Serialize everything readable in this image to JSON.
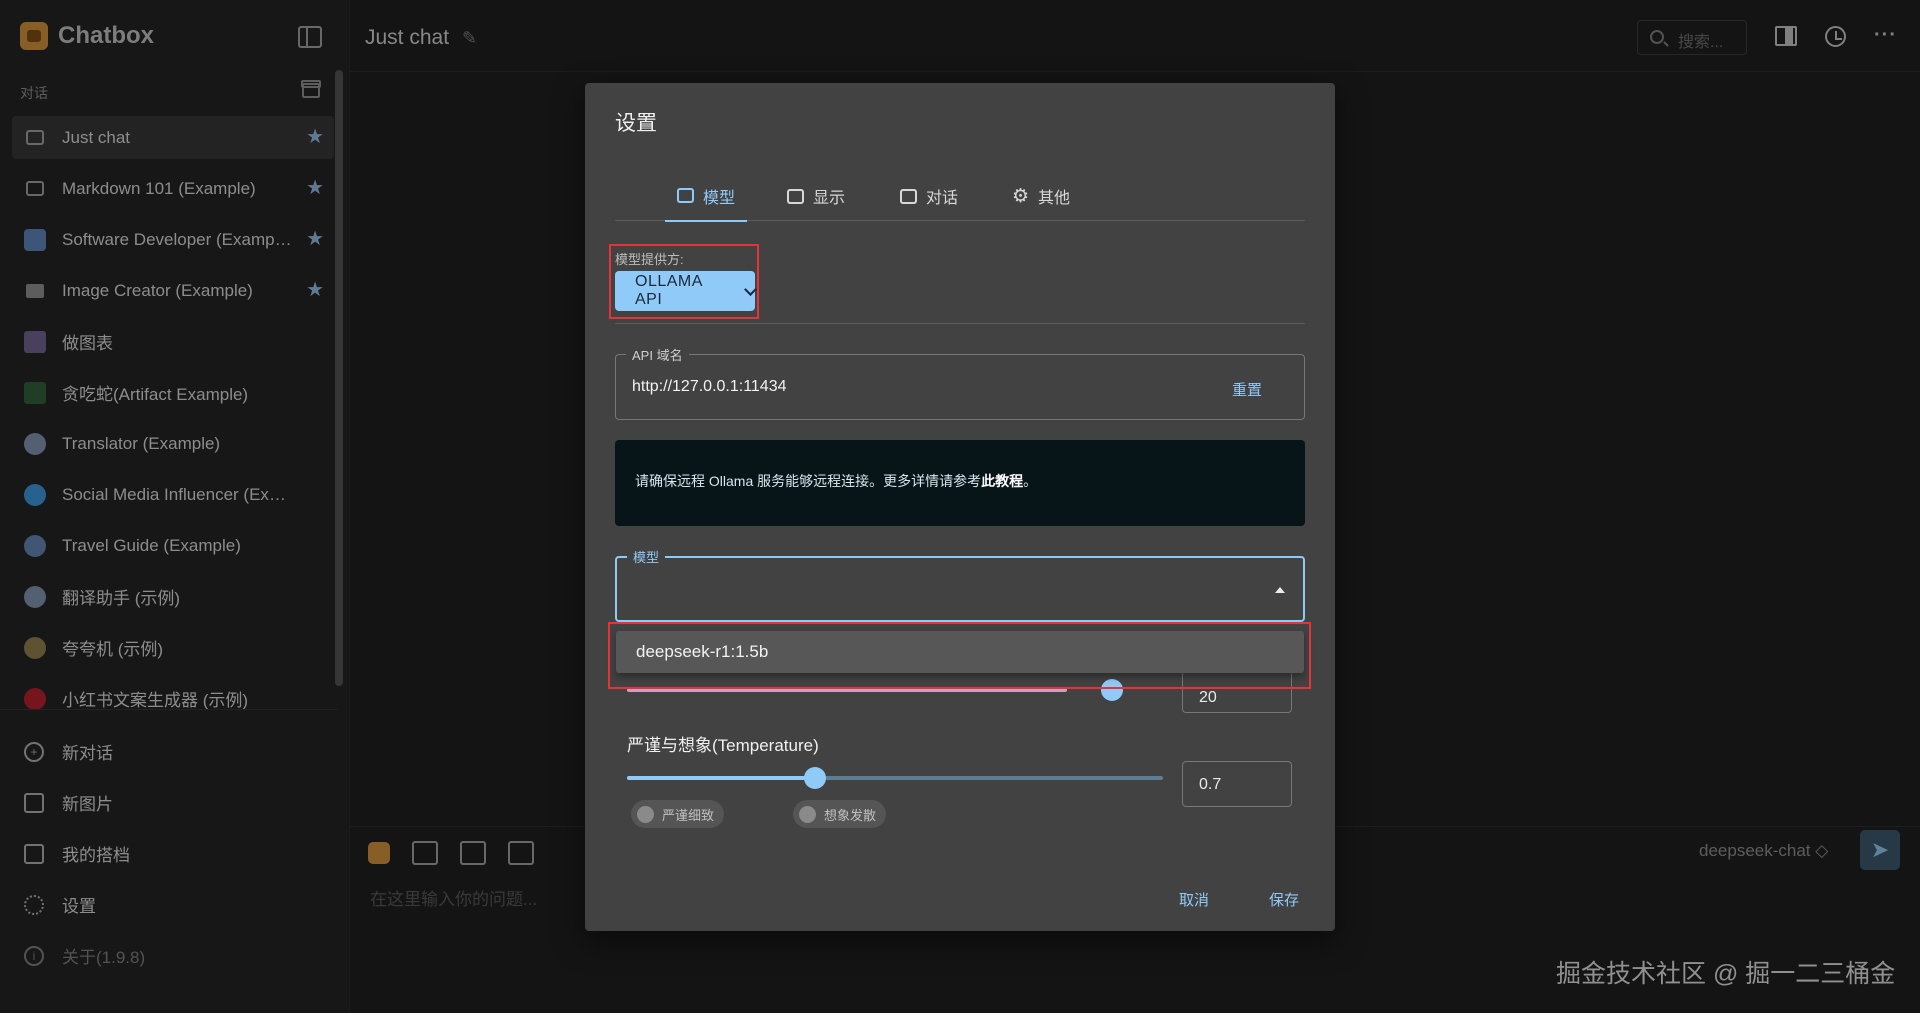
{
  "app": {
    "name": "Chatbox"
  },
  "sidebar": {
    "section_label": "对话",
    "conversations": [
      {
        "label": "Just chat",
        "icon": "chat-bubble-icon",
        "starred": true,
        "active": true
      },
      {
        "label": "Markdown 101 (Example)",
        "icon": "chat-bubble-icon",
        "starred": true
      },
      {
        "label": "Software Developer (Exampl...",
        "icon": "developer-avatar-icon",
        "starred": true
      },
      {
        "label": "Image Creator (Example)",
        "icon": "image-icon",
        "starred": true
      },
      {
        "label": "做图表",
        "icon": "chart-avatar-icon",
        "starred": false
      },
      {
        "label": "贪吃蛇(Artifact Example)",
        "icon": "snake-avatar-icon",
        "starred": false
      },
      {
        "label": "Translator (Example)",
        "icon": "translator-avatar-icon",
        "starred": false
      },
      {
        "label": "Social Media Influencer (Example)",
        "icon": "twitter-avatar-icon",
        "starred": false
      },
      {
        "label": "Travel Guide (Example)",
        "icon": "globe-avatar-icon",
        "starred": false
      },
      {
        "label": "翻译助手 (示例)",
        "icon": "translator-avatar-icon",
        "starred": false
      },
      {
        "label": "夸夸机 (示例)",
        "icon": "cheer-avatar-icon",
        "starred": false
      },
      {
        "label": "小红书文案生成器 (示例)",
        "icon": "xiaohongshu-avatar-icon",
        "starred": false
      }
    ],
    "actions": [
      {
        "label": "新对话",
        "icon": "plus-circle-icon"
      },
      {
        "label": "新图片",
        "icon": "new-image-icon"
      },
      {
        "label": "我的搭档",
        "icon": "robot-icon"
      },
      {
        "label": "设置",
        "icon": "gear-icon"
      },
      {
        "label": "关于(1.9.8)",
        "icon": "info-icon"
      }
    ]
  },
  "topbar": {
    "chat_title": "Just chat",
    "search_placeholder": "搜索..."
  },
  "input": {
    "placeholder": "在这里输入你的问题...",
    "model": "deepseek-chat ◇"
  },
  "settings": {
    "title": "设置",
    "tabs": [
      "模型",
      "显示",
      "对话",
      "其他"
    ],
    "provider_label": "模型提供方:",
    "provider_value": "OLLAMA API",
    "api_host_label": "API 域名",
    "api_host_value": "http://127.0.0.1:11434",
    "reset_label": "重置",
    "info_text": "请确保远程 Ollama 服务能够远程连接。更多详情请参考",
    "info_link": "此教程",
    "info_end": "。",
    "model_label": "模型",
    "model_option": "deepseek-r1:1.5b",
    "context_value": "20",
    "temperature_label": "严谨与想象(Temperature)",
    "temperature_value": "0.7",
    "temperature_fraction": 0.35,
    "chip_rigorous": "严谨细致",
    "chip_imaginative": "想象发散",
    "cancel_label": "取消",
    "save_label": "保存"
  },
  "colors": {
    "accent": "#90caf9",
    "highlight": "#e5333a",
    "star": "#8fb3d9"
  },
  "watermark": "掘金技术社区 @ 掘一二三桶金"
}
